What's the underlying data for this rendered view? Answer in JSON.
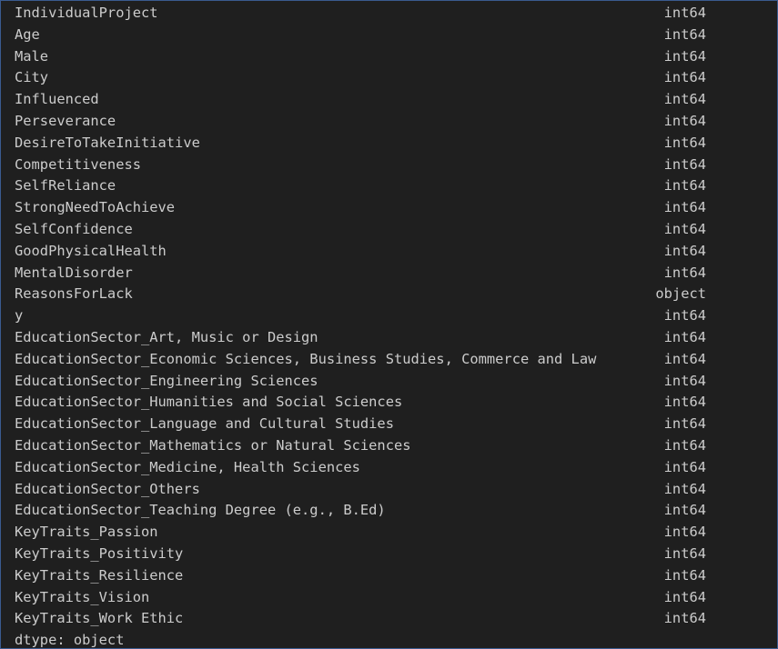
{
  "output": {
    "rows": [
      {
        "name": "IndividualProject",
        "dtype": "int64"
      },
      {
        "name": "Age",
        "dtype": "int64"
      },
      {
        "name": "Male",
        "dtype": "int64"
      },
      {
        "name": "City",
        "dtype": "int64"
      },
      {
        "name": "Influenced",
        "dtype": "int64"
      },
      {
        "name": "Perseverance",
        "dtype": "int64"
      },
      {
        "name": "DesireToTakeInitiative",
        "dtype": "int64"
      },
      {
        "name": "Competitiveness",
        "dtype": "int64"
      },
      {
        "name": "SelfReliance",
        "dtype": "int64"
      },
      {
        "name": "StrongNeedToAchieve",
        "dtype": "int64"
      },
      {
        "name": "SelfConfidence",
        "dtype": "int64"
      },
      {
        "name": "GoodPhysicalHealth",
        "dtype": "int64"
      },
      {
        "name": "MentalDisorder",
        "dtype": "int64"
      },
      {
        "name": "ReasonsForLack",
        "dtype": "object"
      },
      {
        "name": "y",
        "dtype": "int64"
      },
      {
        "name": "EducationSector_Art, Music or Design",
        "dtype": "int64"
      },
      {
        "name": "EducationSector_Economic Sciences, Business Studies, Commerce and Law",
        "dtype": "int64"
      },
      {
        "name": "EducationSector_Engineering Sciences",
        "dtype": "int64"
      },
      {
        "name": "EducationSector_Humanities and Social Sciences",
        "dtype": "int64"
      },
      {
        "name": "EducationSector_Language and Cultural Studies",
        "dtype": "int64"
      },
      {
        "name": "EducationSector_Mathematics or Natural Sciences",
        "dtype": "int64"
      },
      {
        "name": "EducationSector_Medicine, Health Sciences",
        "dtype": "int64"
      },
      {
        "name": "EducationSector_Others",
        "dtype": "int64"
      },
      {
        "name": "EducationSector_Teaching Degree (e.g., B.Ed)",
        "dtype": "int64"
      },
      {
        "name": "KeyTraits_Passion",
        "dtype": "int64"
      },
      {
        "name": "KeyTraits_Positivity",
        "dtype": "int64"
      },
      {
        "name": "KeyTraits_Resilience",
        "dtype": "int64"
      },
      {
        "name": "KeyTraits_Vision",
        "dtype": "int64"
      },
      {
        "name": "KeyTraits_Work Ethic",
        "dtype": "int64"
      }
    ],
    "footer": "dtype: object"
  },
  "colors": {
    "background": "#1f1f1f",
    "text": "#cccccc",
    "border": "#3a5a8f"
  }
}
